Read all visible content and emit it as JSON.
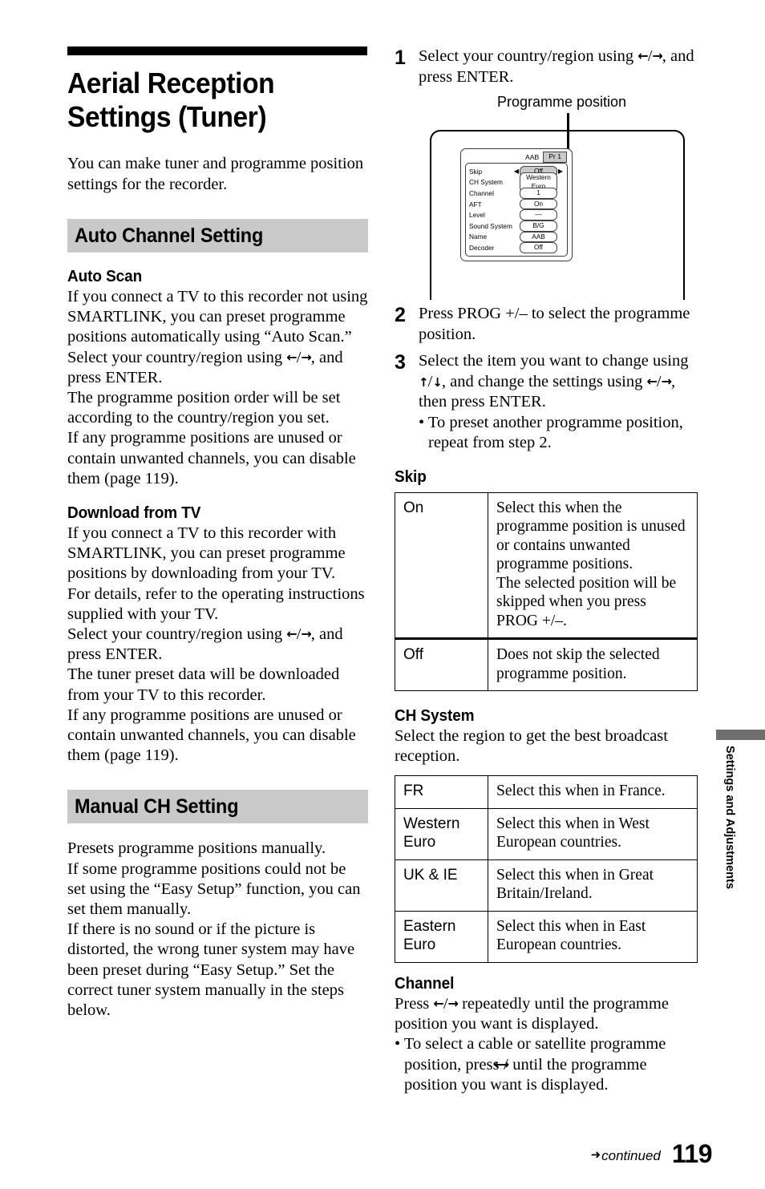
{
  "page": {
    "number": "119",
    "continued_label": "continued",
    "continued_arrow": "➜",
    "side_tab_text": "Settings and Adjustments"
  },
  "title": "Aerial Reception Settings (Tuner)",
  "intro": "You can make tuner and programme position settings for the recorder.",
  "sections": {
    "auto_channel": {
      "heading": "Auto Channel Setting",
      "auto_scan": {
        "heading": "Auto Scan",
        "p1": "If you connect a TV to this recorder not using SMARTLINK, you can preset programme positions automatically using “Auto Scan.”",
        "p2_pre": "Select your country/region using ",
        "p2_post": ", and press ENTER.",
        "p3": "The programme position order will be set according to the country/region you set.",
        "p4": "If any programme positions are unused or contain unwanted channels, you can disable them (page 119)."
      },
      "download_tv": {
        "heading": "Download from TV",
        "p1": "If you connect a TV to this recorder with SMARTLINK, you can preset programme positions by downloading from your TV.",
        "p2": "For details, refer to the operating instructions supplied with your TV.",
        "p3_pre": "Select your country/region using ",
        "p3_post": ", and press ENTER.",
        "p4": "The tuner preset data will be downloaded from your TV to this recorder.",
        "p5": "If any programme positions are unused or contain unwanted channels, you can disable them (page 119)."
      }
    },
    "manual_ch": {
      "heading": "Manual CH Setting",
      "p1": "Presets programme positions manually.",
      "p2": "If some programme positions could not be set using the “Easy Setup” function, you can set them manually.",
      "p3": "If there is no sound or if the picture is distorted, the wrong tuner system may have been preset during “Easy Setup.” Set the correct tuner system manually in the steps below."
    }
  },
  "steps": [
    {
      "num": "1",
      "text_pre": "Select your country/region using ",
      "text_post": ", and press ENTER."
    },
    {
      "num": "2",
      "text_full": "Press PROG +/– to select the programme position."
    },
    {
      "num": "3",
      "text_a": "Select the item you want to change using ",
      "text_b": ", and change the settings using ",
      "text_c": ", then press ENTER.",
      "bullet": "• To preset another programme position, repeat from step 2."
    }
  ],
  "arrows": {
    "left": "←",
    "right": "→",
    "up": "↑",
    "down": "↓",
    "slash": "/"
  },
  "diagram": {
    "callout_label": "Programme position",
    "osd": {
      "name_badge": "AAB",
      "pr_badge": "Pr 1",
      "rows": [
        {
          "label": "Skip",
          "value": "Off",
          "selected": true
        },
        {
          "label": "CH System",
          "value": "Western Euro",
          "selected": false
        },
        {
          "label": "Channel",
          "value": "1",
          "selected": false
        },
        {
          "label": "AFT",
          "value": "On",
          "selected": false
        },
        {
          "label": "Level",
          "value": "—",
          "selected": false
        },
        {
          "label": "Sound System",
          "value": "B/G",
          "selected": false
        },
        {
          "label": "Name",
          "value": "AAB",
          "selected": false
        },
        {
          "label": "Decoder",
          "value": "Off",
          "selected": false
        }
      ],
      "arrow_left": "◀",
      "arrow_right": "▶"
    }
  },
  "tables": {
    "skip": {
      "heading": "Skip",
      "rows": [
        {
          "key": "On",
          "value": "Select this when the programme position is unused or contains unwanted programme positions.\nThe selected position will be skipped when you press PROG +/–."
        },
        {
          "key": "Off",
          "value": "Does not skip the selected programme position."
        }
      ]
    },
    "ch_system": {
      "heading": "CH System",
      "intro": "Select the region to get the best broadcast reception.",
      "rows": [
        {
          "key": "FR",
          "value": "Select this when in France."
        },
        {
          "key": "Western Euro",
          "value": "Select this when in West European countries."
        },
        {
          "key": "UK & IE",
          "value": "Select this when in Great Britain/Ireland."
        },
        {
          "key": "Eastern Euro",
          "value": "Select this when in East European countries."
        }
      ]
    }
  },
  "channel_section": {
    "heading": "Channel",
    "p1_pre": "Press ",
    "p1_post": " repeatedly until the programme position you want is displayed.",
    "bullet_pre": "• To select a cable or satellite programme position, press ",
    "bullet_post": " until the programme position you want is displayed."
  }
}
